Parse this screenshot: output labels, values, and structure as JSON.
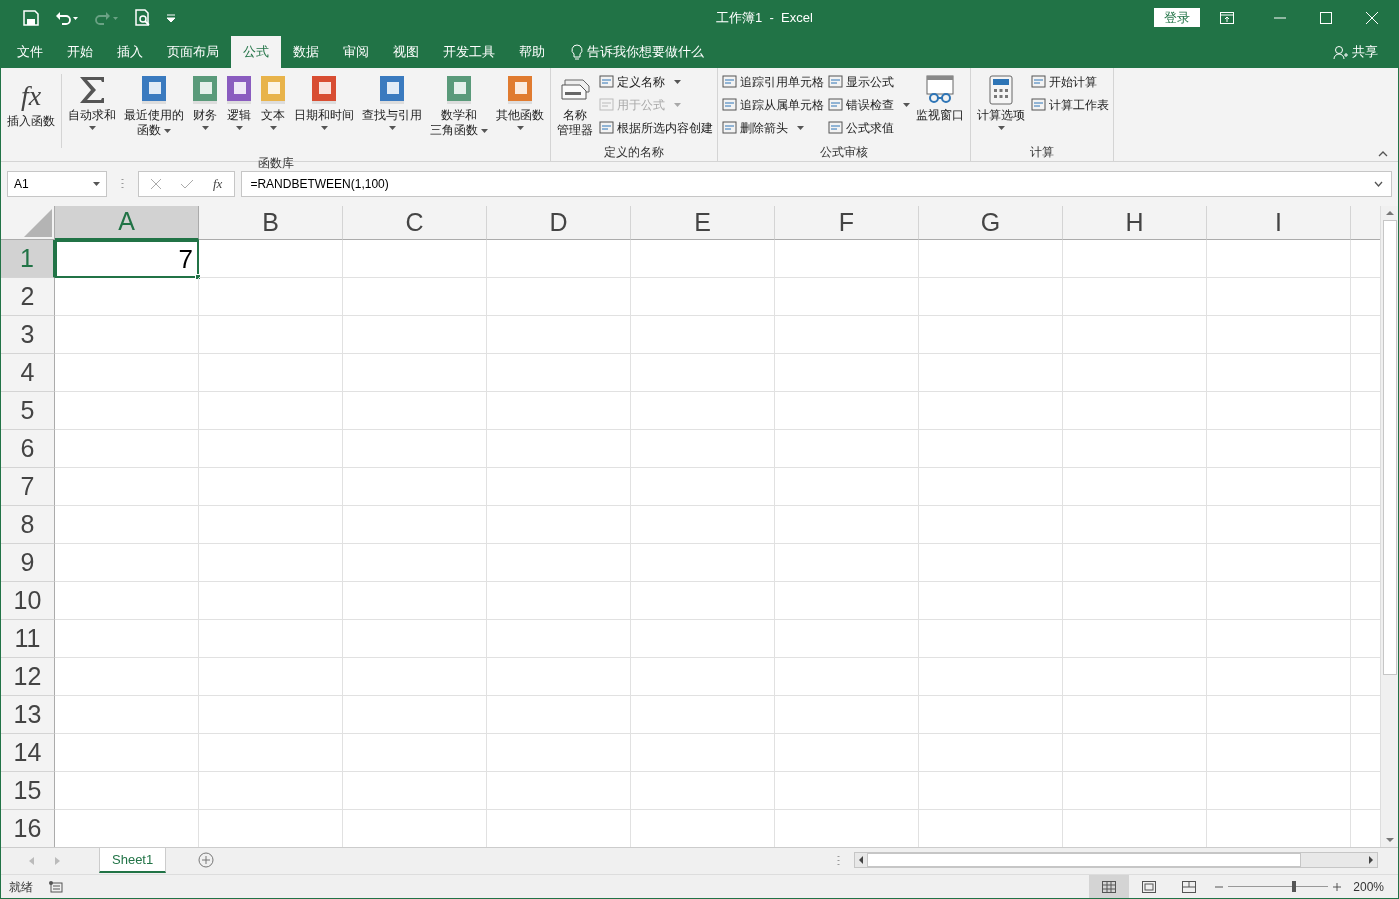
{
  "window": {
    "title": "工作簿1  -  Excel",
    "login": "登录"
  },
  "menu_tabs": [
    {
      "label": "文件",
      "selected": false
    },
    {
      "label": "开始",
      "selected": false
    },
    {
      "label": "插入",
      "selected": false
    },
    {
      "label": "页面布局",
      "selected": false
    },
    {
      "label": "公式",
      "selected": true
    },
    {
      "label": "数据",
      "selected": false
    },
    {
      "label": "审阅",
      "selected": false
    },
    {
      "label": "视图",
      "selected": false
    },
    {
      "label": "开发工具",
      "selected": false
    },
    {
      "label": "帮助",
      "selected": false
    }
  ],
  "tell_me": "告诉我你想要做什么",
  "share": "共享",
  "ribbon_groups": [
    {
      "label": "函数库",
      "controls": [
        {
          "kind": "large",
          "glyph": "fx",
          "lines": [
            "插入函数"
          ],
          "dropdown": false
        },
        {
          "kind": "large",
          "lines": [
            "自动求和"
          ],
          "dropdown": true
        },
        {
          "kind": "large",
          "lines": [
            "最近使用的",
            "函数"
          ],
          "dropdown": true
        },
        {
          "kind": "large",
          "lines": [
            "财务"
          ],
          "dropdown": true
        },
        {
          "kind": "large",
          "lines": [
            "逻辑"
          ],
          "dropdown": true
        },
        {
          "kind": "large",
          "lines": [
            "文本"
          ],
          "dropdown": true
        },
        {
          "kind": "large",
          "lines": [
            "日期和时间"
          ],
          "dropdown": true
        },
        {
          "kind": "large",
          "lines": [
            "查找与引用"
          ],
          "dropdown": true
        },
        {
          "kind": "large",
          "lines": [
            "数学和",
            "三角函数"
          ],
          "dropdown": true
        },
        {
          "kind": "large",
          "lines": [
            "其他函数"
          ],
          "dropdown": true
        }
      ]
    },
    {
      "label": "定义的名称",
      "controls": [
        {
          "kind": "large",
          "lines": [
            "名称",
            "管理器"
          ],
          "dropdown": false
        },
        {
          "kind": "stack",
          "items": [
            {
              "label": "定义名称",
              "dropdown": true,
              "disabled": false
            },
            {
              "label": "用于公式",
              "dropdown": true,
              "disabled": true
            },
            {
              "label": "根据所选内容创建",
              "dropdown": false,
              "disabled": false
            }
          ]
        }
      ]
    },
    {
      "label": "公式审核",
      "controls": [
        {
          "kind": "stack",
          "items": [
            {
              "label": "追踪引用单元格",
              "dropdown": false,
              "disabled": false
            },
            {
              "label": "追踪从属单元格",
              "dropdown": false,
              "disabled": false
            },
            {
              "label": "删除箭头",
              "dropdown": true,
              "disabled": false
            }
          ]
        },
        {
          "kind": "stack",
          "items": [
            {
              "label": "显示公式",
              "dropdown": false,
              "disabled": false
            },
            {
              "label": "错误检查",
              "dropdown": true,
              "disabled": false
            },
            {
              "label": "公式求值",
              "dropdown": false,
              "disabled": false
            }
          ]
        },
        {
          "kind": "large",
          "lines": [
            "监视窗口"
          ],
          "dropdown": false
        }
      ]
    },
    {
      "label": "计算",
      "controls": [
        {
          "kind": "large",
          "lines": [
            "计算选项"
          ],
          "dropdown": true
        },
        {
          "kind": "stack",
          "items": [
            {
              "label": "开始计算",
              "dropdown": false,
              "disabled": false
            },
            {
              "label": "计算工作表",
              "dropdown": false,
              "disabled": false
            }
          ]
        }
      ]
    }
  ],
  "formula_bar": {
    "name_box": "A1",
    "fx": "fx",
    "formula": "=RANDBETWEEN(1,100)"
  },
  "grid": {
    "columns": [
      {
        "label": "A",
        "selected": true
      },
      {
        "label": "B",
        "selected": false
      },
      {
        "label": "C",
        "selected": false
      },
      {
        "label": "D",
        "selected": false
      },
      {
        "label": "E",
        "selected": false
      },
      {
        "label": "F",
        "selected": false
      },
      {
        "label": "G",
        "selected": false
      },
      {
        "label": "H",
        "selected": false
      },
      {
        "label": "I",
        "selected": false
      }
    ],
    "rows": [
      {
        "label": "1",
        "selected": true,
        "cells": [
          "7"
        ]
      },
      {
        "label": "2",
        "selected": false,
        "cells": []
      },
      {
        "label": "3",
        "selected": false,
        "cells": []
      },
      {
        "label": "4",
        "selected": false,
        "cells": []
      },
      {
        "label": "5",
        "selected": false,
        "cells": []
      },
      {
        "label": "6",
        "selected": false,
        "cells": []
      },
      {
        "label": "7",
        "selected": false,
        "cells": []
      },
      {
        "label": "8",
        "selected": false,
        "cells": []
      },
      {
        "label": "9",
        "selected": false,
        "cells": []
      },
      {
        "label": "10",
        "selected": false,
        "cells": []
      },
      {
        "label": "11",
        "selected": false,
        "cells": []
      },
      {
        "label": "12",
        "selected": false,
        "cells": []
      },
      {
        "label": "13",
        "selected": false,
        "cells": []
      },
      {
        "label": "14",
        "selected": false,
        "cells": []
      },
      {
        "label": "15",
        "selected": false,
        "cells": []
      },
      {
        "label": "16",
        "selected": false,
        "cells": []
      }
    ]
  },
  "sheet_tabs": [
    {
      "label": "Sheet1",
      "selected": true
    }
  ],
  "status_bar": {
    "status": "就绪",
    "view_buttons": [
      {
        "selected": true
      },
      {
        "selected": false
      },
      {
        "selected": false
      }
    ],
    "zoom": {
      "level": 0.66,
      "reading": "200%"
    }
  }
}
